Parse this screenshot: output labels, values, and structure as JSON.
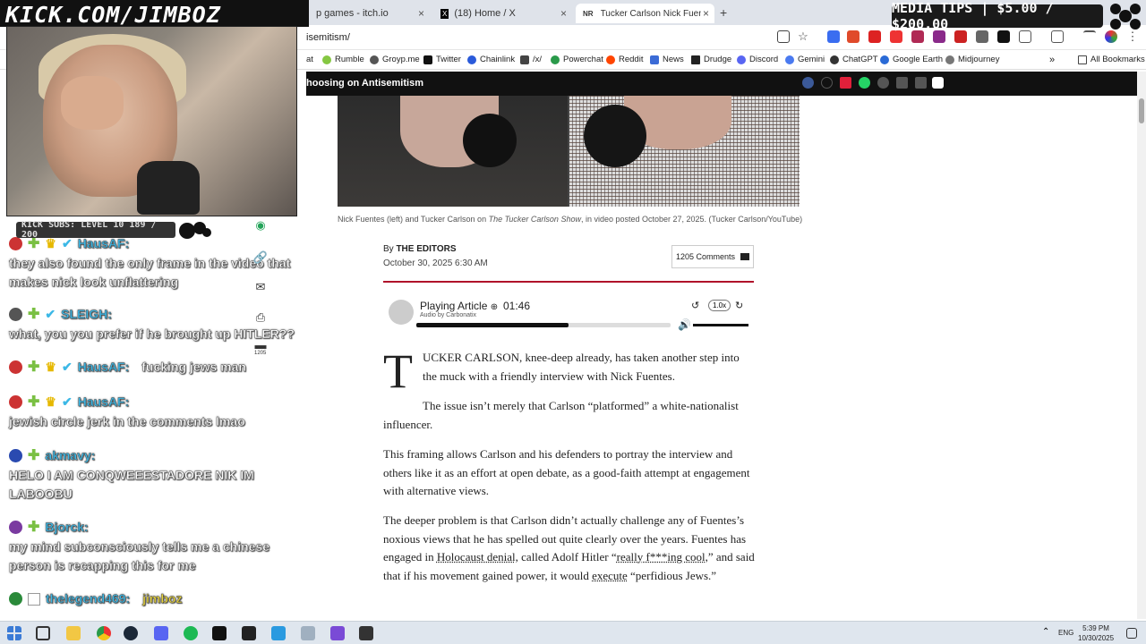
{
  "overlay": {
    "kick_url": "KICK.COM/JIMBOZ",
    "media_tips": "MEDIA TIPS | $5.00 / $200.00",
    "subs": "KICK SUBS: LEVEL 10 189 / 200"
  },
  "tabs": [
    {
      "label": "p games - itch.io",
      "close": "×"
    },
    {
      "label": "(18) Home / X",
      "close": "×"
    },
    {
      "label": "Tucker Carlson Nick Fuentes Int",
      "close": "×",
      "icon_text": "NR"
    }
  ],
  "new_tab": "+",
  "address": {
    "url": "isemitism/"
  },
  "bookmarks": {
    "items": [
      "at",
      "Rumble",
      "Groyp.me",
      "Twitter",
      "Chainlink",
      "/x/",
      "Powerchat",
      "Reddit",
      "News",
      "Drudge",
      "Discord",
      "Gemini",
      "ChatGPT",
      "Google Earth",
      "Midjourney"
    ],
    "more": "»",
    "all": "All Bookmarks"
  },
  "chat": [
    {
      "user": "HausAF:",
      "message": "they also found the only frame in the video that makes nick look unflattering",
      "user_color": "#3cb8e6"
    },
    {
      "user": "SLEIGH:",
      "message": "what, you you prefer if he brought up HITLER??",
      "user_color": "#3cb8e6"
    },
    {
      "user": "HausAF:",
      "message": "fucking jews man",
      "user_color": "#3cb8e6"
    },
    {
      "user": "HausAF:",
      "message": "jewish circle jerk in the comments lmao",
      "user_color": "#3cb8e6"
    },
    {
      "user": "akmavy:",
      "message": "HELO I AM CONQWEEESTADORE NIK IM LABOOBU",
      "user_color": "#3cb8e6"
    },
    {
      "user": "Bjorck:",
      "message": "my mind subconsciously tells me a chinese person is recapping this for me",
      "user_color": "#3cb8e6"
    },
    {
      "user": "thelegend469:",
      "message": "jimboz",
      "user_color": "#3cb8e6",
      "message_color": "#e6d23c"
    }
  ],
  "side_comment_count": "1205",
  "article": {
    "bar_title": "hoosing on Antisemitism",
    "caption_pre": "Nick Fuentes (left) and Tucker Carlson on ",
    "caption_show": "The Tucker Carlson Show",
    "caption_post": ", in video posted October 27, 2025. (Tucker Carlson/YouTube)",
    "by": "By ",
    "author": "THE EDITORS",
    "date": "October 30, 2025 6:30 AM",
    "comments": "1205 Comments",
    "player": {
      "label": "Playing Article",
      "time": "01:46",
      "audio_by": "Audio by Carbonatix",
      "speed": "1.0x",
      "progress": 0.6
    },
    "dropcap": "T",
    "p1_smallcaps": "UCKER CARLSON",
    "p1_rest": ", knee-deep already, has taken another step into the muck with a friendly interview with Nick Fuentes.",
    "p2": "The issue isn’t merely that Carlson “platformed” a white-nationalist influencer.",
    "p3": "This framing allows Carlson and his defenders to portray the interview and others like it as an effort at open debate, as a good-faith attempt at engagement with alternative views.",
    "p4_a": "The deeper problem is that Carlson didn’t actually challenge any of Fuentes’s noxious views that he has spelled out quite clearly over the years. Fuentes has engaged in ",
    "p4_link1": "Holocaust denial",
    "p4_b": ", called Adolf Hitler “",
    "p4_link2": "really f***ing cool",
    "p4_c": ",” and said that if his movement gained power, it would ",
    "p4_link3": "execute",
    "p4_d": " “perfidious Jews.”"
  },
  "taskbar": {
    "lang": "ENG",
    "time": "5:39 PM",
    "date": "10/30/2025"
  },
  "colors": {
    "accent_red": "#b0122a",
    "chat_user": "#3cb8e6"
  }
}
